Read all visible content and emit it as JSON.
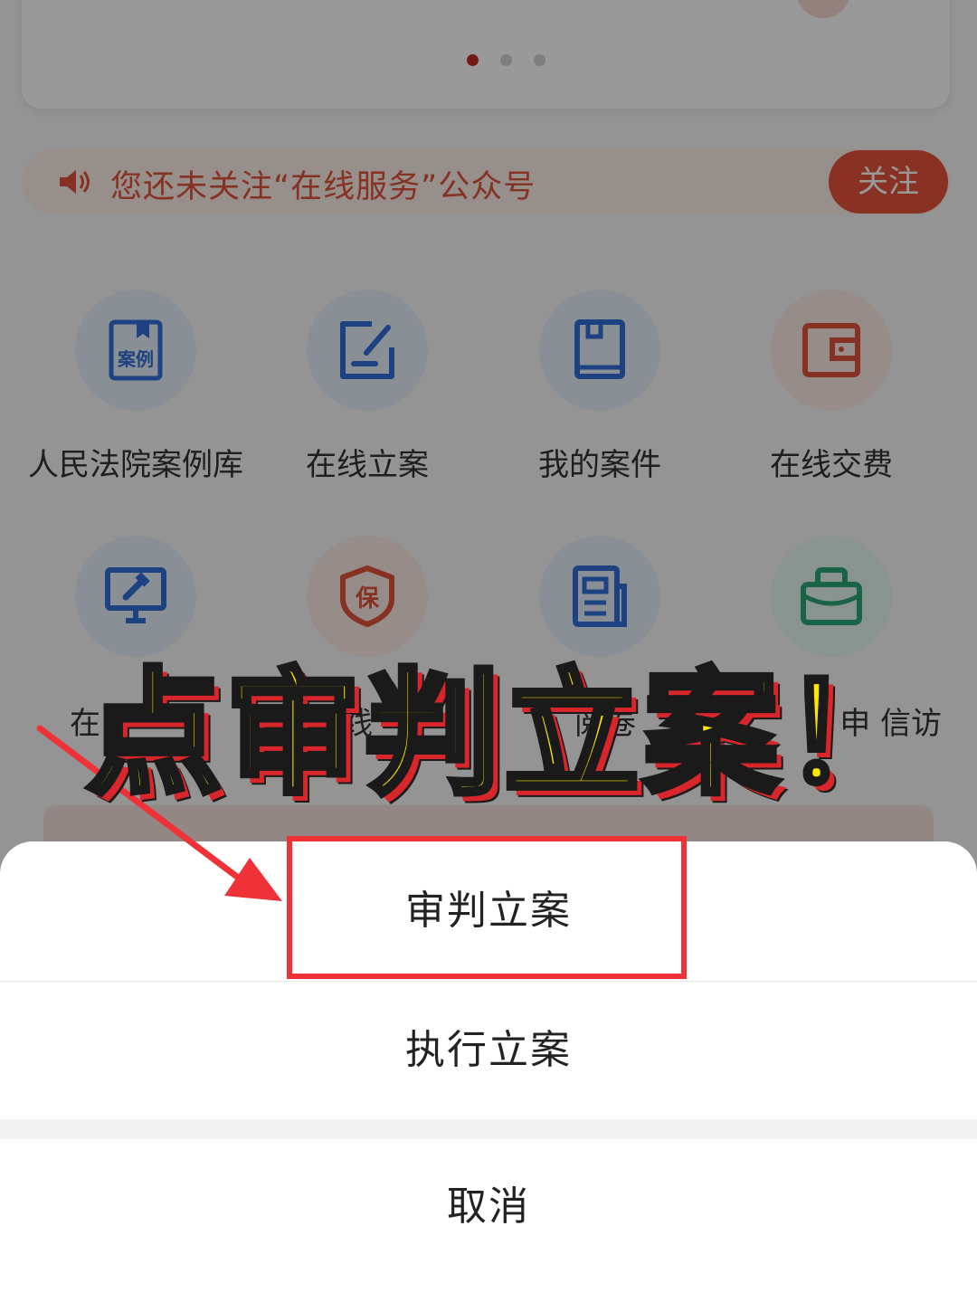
{
  "banner": {
    "dots": 3,
    "active_dot": 1
  },
  "notice": {
    "icon": "speaker-icon",
    "text": "您还未关注“在线服务”公众号",
    "follow_label": "关注"
  },
  "services": [
    {
      "label": "人民法院案例库",
      "icon": "case-library-icon",
      "icon_text": "案例",
      "color": "#2f6fd8",
      "bg": "#e6eefb"
    },
    {
      "label": "在线立案",
      "icon": "edit-filing-icon",
      "color": "#2f6fd8",
      "bg": "#e6eefb"
    },
    {
      "label": "我的案件",
      "icon": "book-icon",
      "color": "#2f6fd8",
      "bg": "#e6eefb"
    },
    {
      "label": "在线交费",
      "icon": "wallet-icon",
      "color": "#e2533a",
      "bg": "#fbece6"
    },
    {
      "label": "在",
      "icon": "court-monitor-icon",
      "color": "#2f6fd8",
      "bg": "#e6eefb"
    },
    {
      "label": "线",
      "icon": "shield-icon",
      "icon_text": "保",
      "color": "#e2533a",
      "bg": "#fbece6"
    },
    {
      "label": "阅卷",
      "icon": "document-icon",
      "color": "#2f6fd8",
      "bg": "#e6eefb"
    },
    {
      "label": "申 信访",
      "icon": "briefcase-icon",
      "color": "#2aa676",
      "bg": "#e4f5ee"
    }
  ],
  "hidden_card": {
    "text": ""
  },
  "action_sheet": {
    "option_1": "审判立案",
    "option_2": "执行立案",
    "cancel": "取消"
  },
  "annotation": {
    "headline": "点审判立案！",
    "highlight_color": "#ef3138"
  }
}
